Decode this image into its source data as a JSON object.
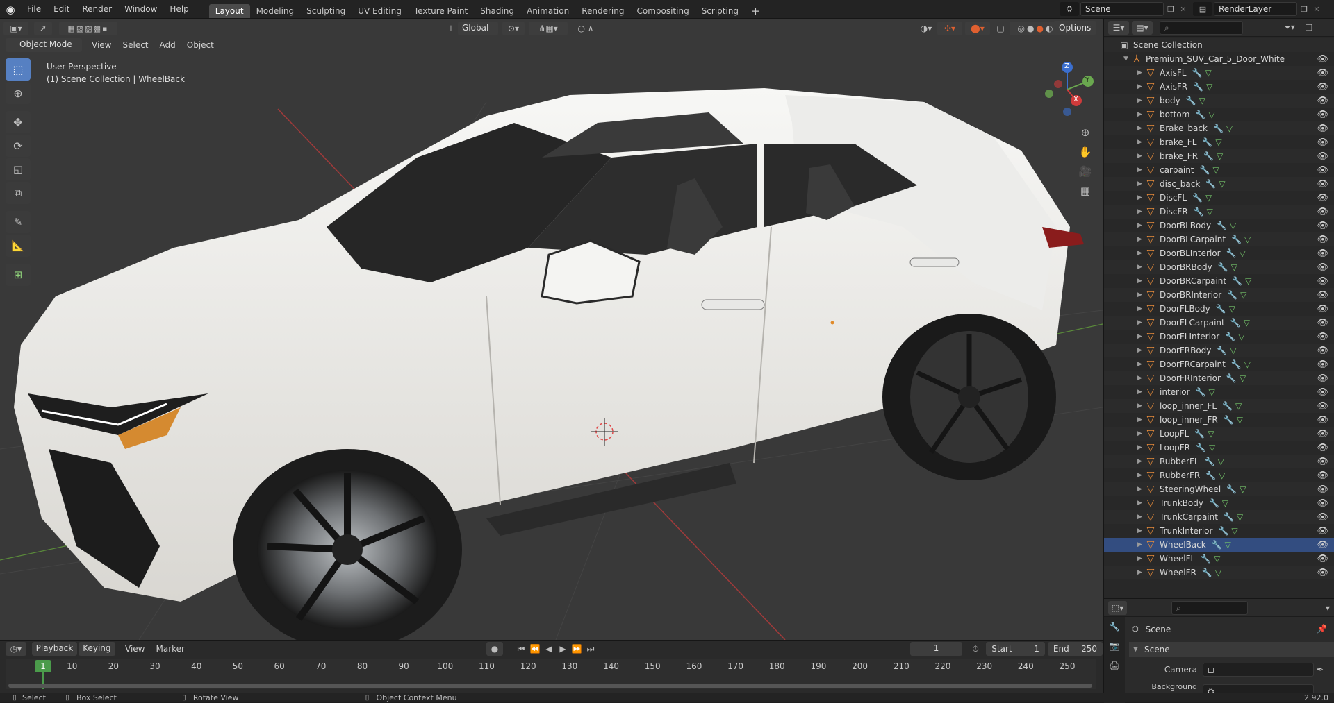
{
  "top_menu": {
    "items": [
      "File",
      "Edit",
      "Render",
      "Window",
      "Help"
    ],
    "workspaces": [
      "Layout",
      "Modeling",
      "Sculpting",
      "UV Editing",
      "Texture Paint",
      "Shading",
      "Animation",
      "Rendering",
      "Compositing",
      "Scripting"
    ],
    "active_workspace": "Layout",
    "scene": "Scene",
    "view_layer": "RenderLayer"
  },
  "viewport": {
    "mode": "Object Mode",
    "menus": [
      "View",
      "Select",
      "Add",
      "Object"
    ],
    "transform_orientation": "Global",
    "options": "Options",
    "overlay_title": "User Perspective",
    "overlay_subtitle": "(1) Scene Collection | WheelBack",
    "gizmo": {
      "z": "Z",
      "y": "Y",
      "x": "X"
    }
  },
  "outliner": {
    "root": "Scene Collection",
    "collection": "Premium_SUV_Car_5_Door_White",
    "selected": "WheelBack",
    "objects": [
      "AxisFL",
      "AxisFR",
      "body",
      "bottom",
      "Brake_back",
      "brake_FL",
      "brake_FR",
      "carpaint",
      "disc_back",
      "DiscFL",
      "DiscFR",
      "DoorBLBody",
      "DoorBLCarpaint",
      "DoorBLInterior",
      "DoorBRBody",
      "DoorBRCarpaint",
      "DoorBRInterior",
      "DoorFLBody",
      "DoorFLCarpaint",
      "DoorFLInterior",
      "DoorFRBody",
      "DoorFRCarpaint",
      "DoorFRInterior",
      "interior",
      "loop_inner_FL",
      "loop_inner_FR",
      "LoopFL",
      "LoopFR",
      "RubberFL",
      "RubberFR",
      "SteeringWheel",
      "TrunkBody",
      "TrunkCarpaint",
      "TrunkInterior",
      "WheelBack",
      "WheelFL",
      "WheelFR"
    ]
  },
  "properties": {
    "breadcrumb": "Scene",
    "panel": "Scene",
    "camera_label": "Camera",
    "background_label": "Background Scene"
  },
  "timeline": {
    "menus": [
      "Playback",
      "Keying",
      "View",
      "Marker"
    ],
    "current_frame": "1",
    "start_label": "Start",
    "start": "1",
    "end_label": "End",
    "end": "250",
    "ticks": [
      "1",
      "10",
      "20",
      "30",
      "40",
      "50",
      "60",
      "70",
      "80",
      "90",
      "100",
      "110",
      "120",
      "130",
      "140",
      "150",
      "160",
      "170",
      "180",
      "190",
      "200",
      "210",
      "220",
      "230",
      "240",
      "250"
    ]
  },
  "statusbar": {
    "select": "Select",
    "box_select": "Box Select",
    "rotate_view": "Rotate View",
    "context_menu": "Object Context Menu",
    "version": "2.92.0"
  }
}
